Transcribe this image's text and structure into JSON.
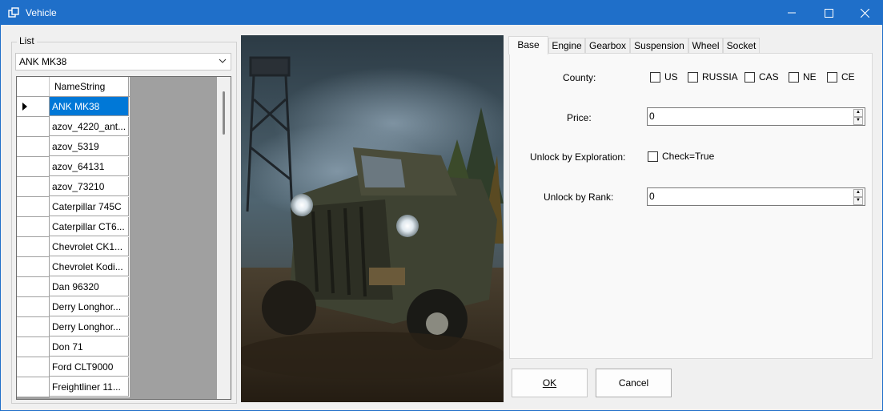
{
  "window": {
    "title": "Vehicle",
    "titlebar_color": "#1f6fc9"
  },
  "list_group": {
    "label": "List",
    "combo_value": "ANK MK38"
  },
  "grid": {
    "column_header": "NameString",
    "selected_color": "#0078d7",
    "rows": [
      "ANK MK38",
      "azov_4220_ant...",
      "azov_5319",
      "azov_64131",
      "azov_73210",
      "Caterpillar 745C",
      "Caterpillar CT6...",
      "Chevrolet CK1...",
      "Chevrolet Kodi...",
      "Dan 96320",
      "Derry Longhor...",
      "Derry Longhor...",
      "Don 71",
      "Ford CLT9000",
      "Freightliner 11..."
    ]
  },
  "tabs": [
    "Base",
    "Engine",
    "Gearbox",
    "Suspension",
    "Wheel",
    "Socket"
  ],
  "base": {
    "country_label": "County:",
    "countries": [
      "US",
      "RUSSIA",
      "CAS",
      "NE",
      "CE"
    ],
    "price_label": "Price:",
    "price_value": "0",
    "exploration_label": "Unlock by Exploration:",
    "exploration_check": "Check=True",
    "rank_label": "Unlock by Rank:",
    "rank_value": "0"
  },
  "buttons": {
    "ok": "OK",
    "cancel": "Cancel"
  }
}
